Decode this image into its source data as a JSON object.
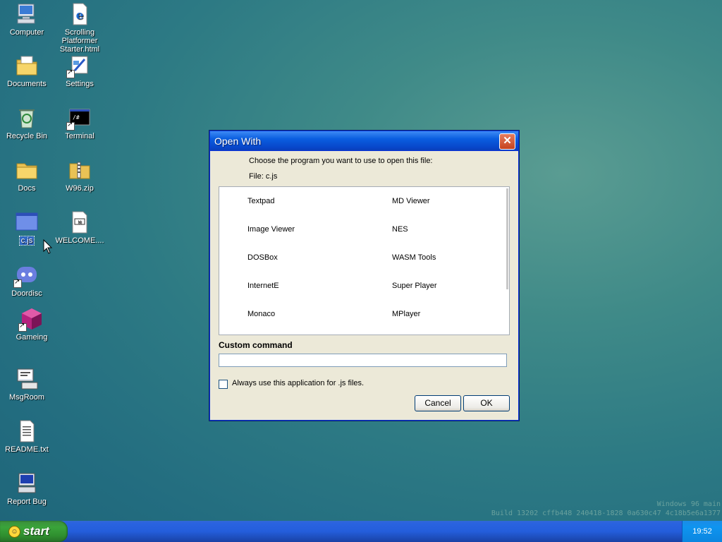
{
  "desktop": {
    "icons": [
      {
        "label": "Computer",
        "icon": "computer-icon"
      },
      {
        "label": "Scrolling Platformer Starter.html",
        "icon": "internet-explorer-icon"
      },
      {
        "label": "Documents",
        "icon": "documents-folder-icon"
      },
      {
        "label": "Settings",
        "icon": "settings-icon"
      },
      {
        "label": "Recycle Bin",
        "icon": "recycle-bin-icon"
      },
      {
        "label": "Terminal",
        "icon": "terminal-icon"
      },
      {
        "label": "Docs",
        "icon": "folder-icon"
      },
      {
        "label": "W96.zip",
        "icon": "zip-icon"
      },
      {
        "label": "c.js",
        "icon": "window-icon"
      },
      {
        "label": "WELCOME....",
        "icon": "markdown-file-icon"
      },
      {
        "label": "Doordisc",
        "icon": "discord-icon"
      },
      {
        "label": "Gameing",
        "icon": "cube-icon"
      },
      {
        "label": "MsgRoom",
        "icon": "msgroom-icon"
      },
      {
        "label": "README.txt",
        "icon": "text-file-icon"
      },
      {
        "label": "Report Bug",
        "icon": "report-bug-icon"
      }
    ]
  },
  "dialog": {
    "title": "Open With",
    "close_label": "✕",
    "prompt": "Choose the program you want to use to open this file:",
    "file_line": "File: c.js",
    "programs_left": [
      "Textpad",
      "Image Viewer",
      "DOSBox",
      "InternetE",
      "Monaco"
    ],
    "programs_right": [
      "MD Viewer",
      "NES",
      "WASM Tools",
      "Super Player",
      "MPlayer"
    ],
    "custom_command_label": "Custom command",
    "custom_command_value": "",
    "always_use_label": "Always use this application for .js files.",
    "always_use_checked": false,
    "cancel_label": "Cancel",
    "ok_label": "OK"
  },
  "taskbar": {
    "start_label": "start",
    "clock": "19:52"
  },
  "watermark": {
    "line1": "Windows 96 main",
    "line2": "Build 13202 cffb448 240418-1828 0a630c47 4c18b5e6a1377"
  },
  "colors": {
    "titlebar": "#0a5ee0",
    "start_button": "#3aa43a",
    "taskbar": "#245edb"
  }
}
